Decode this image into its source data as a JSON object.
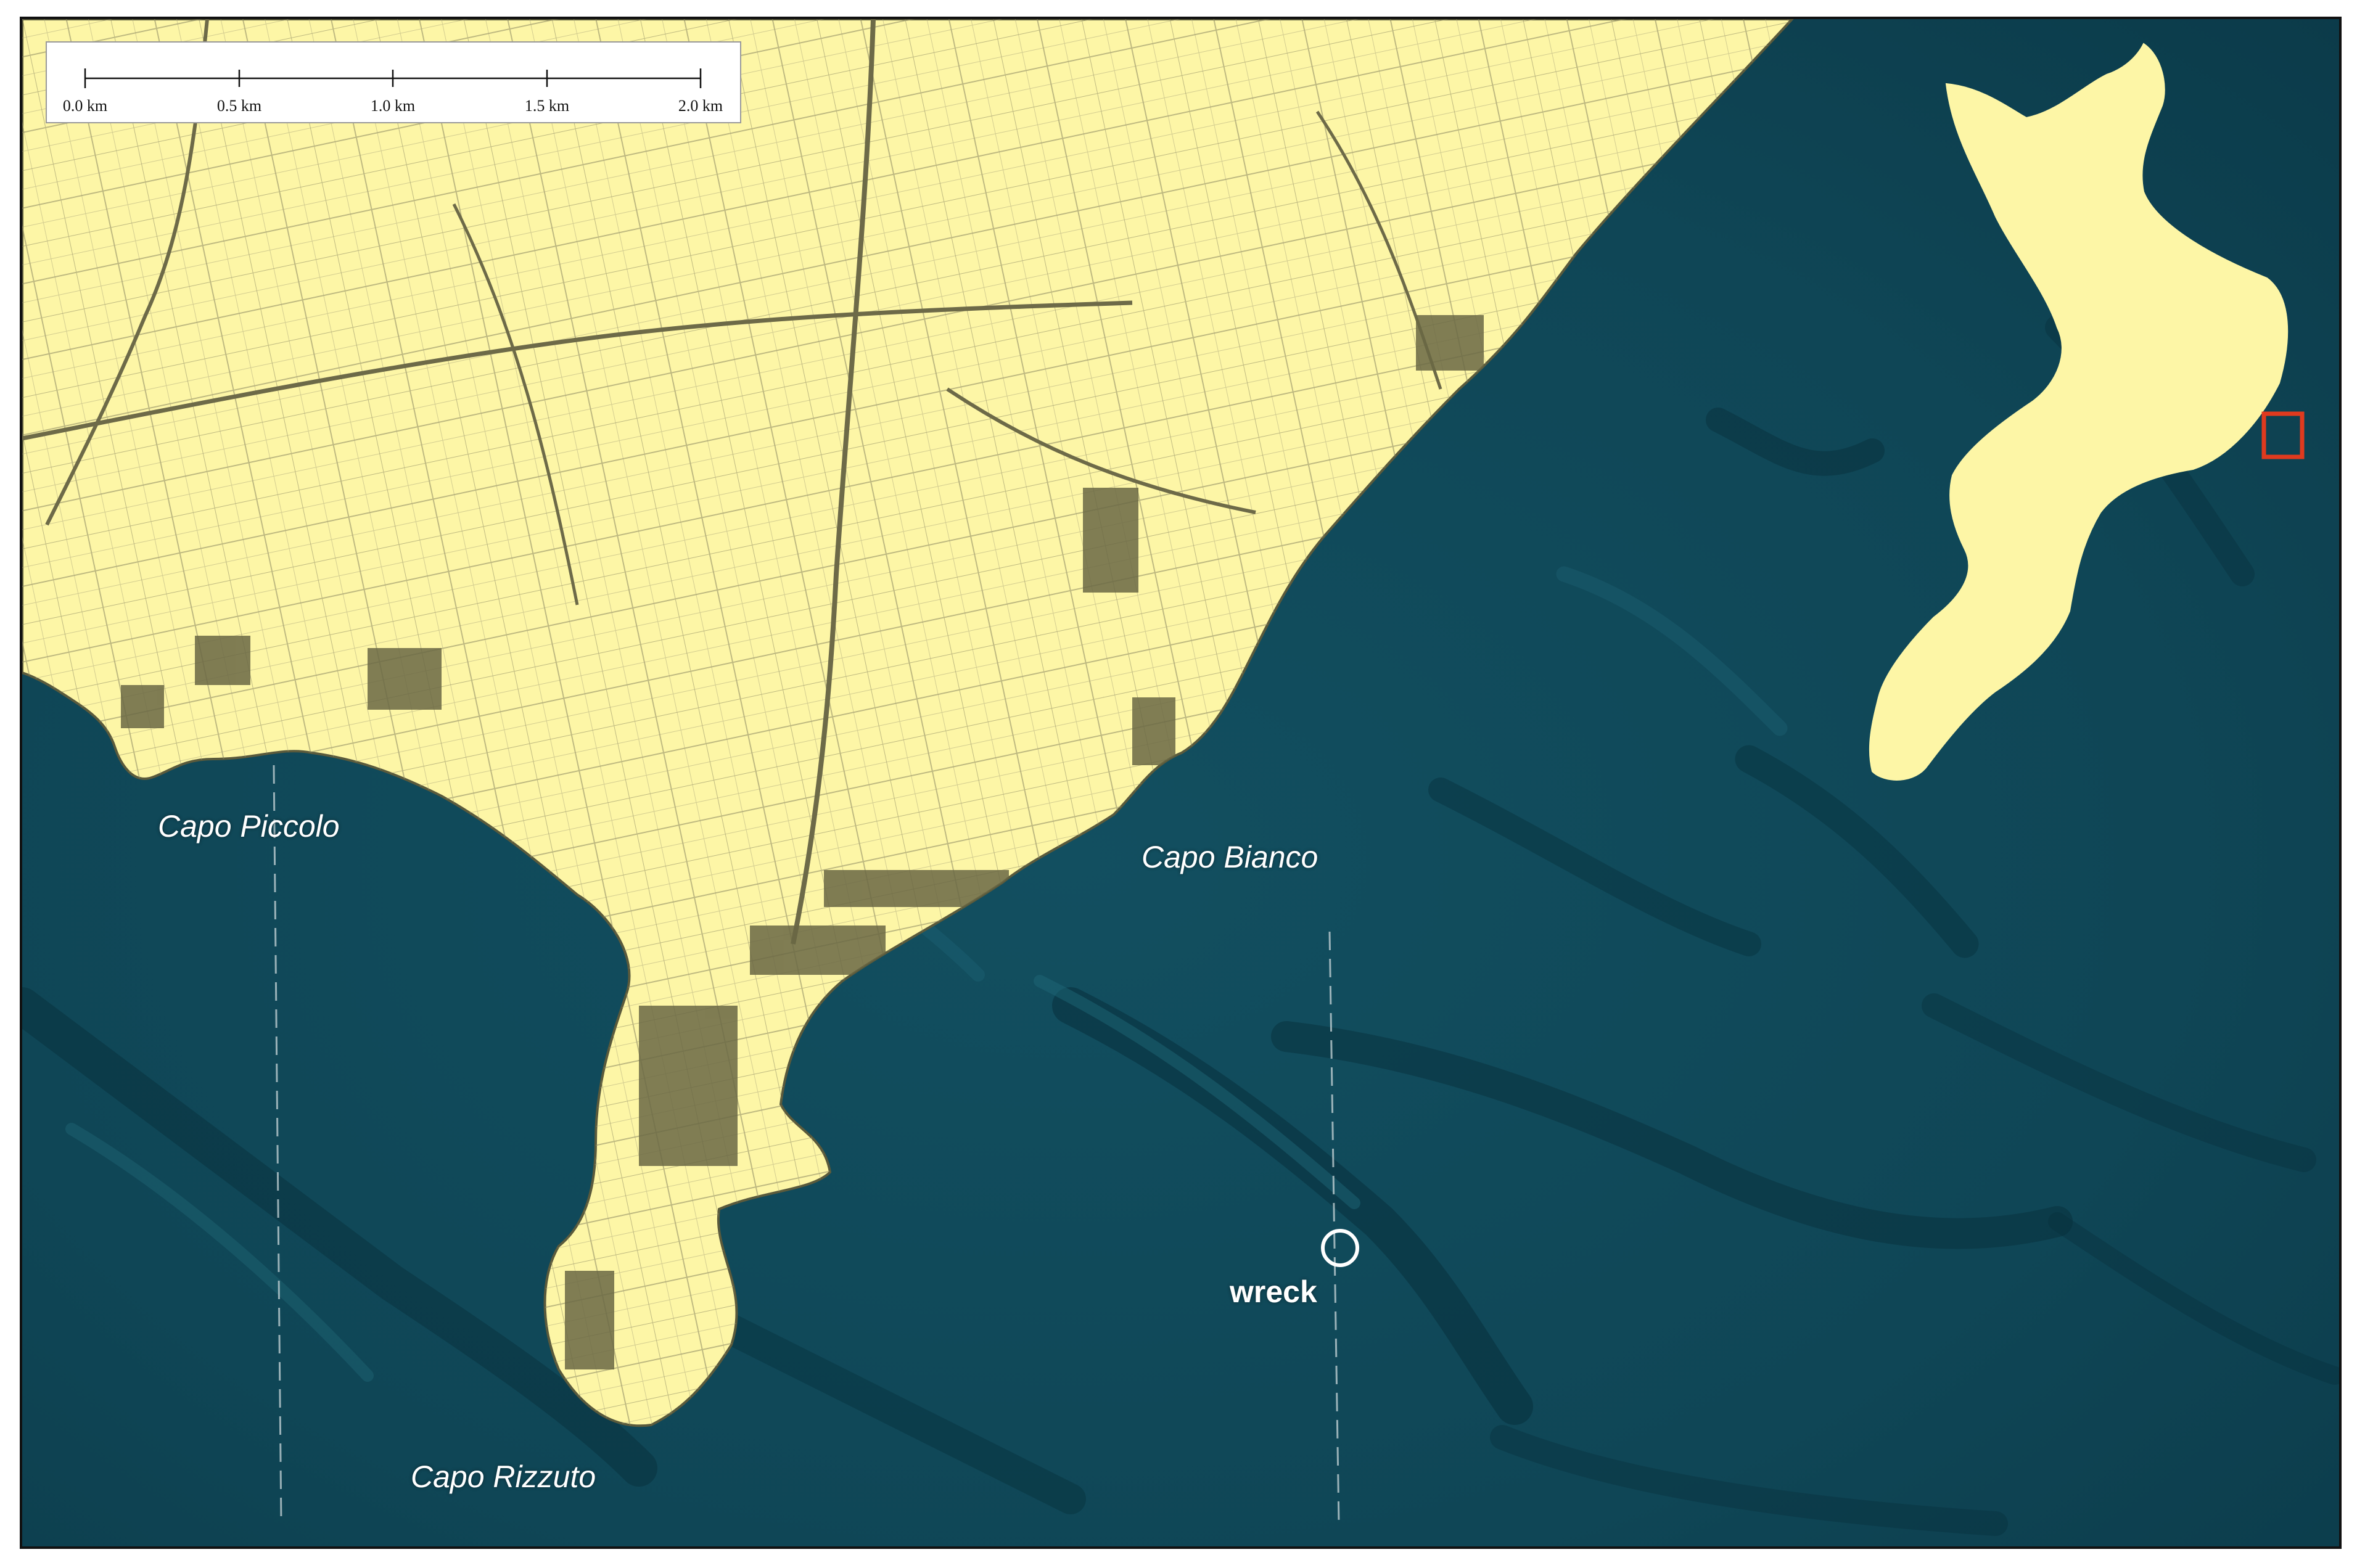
{
  "map": {
    "labels": {
      "capo_piccolo": "Capo Piccolo",
      "capo_bianco": "Capo Bianco",
      "capo_rizzuto": "Capo Rizzuto",
      "wreck": "wreck"
    },
    "scale_bar": {
      "ticks": [
        "0.0 km",
        "0.5 km",
        "1.0 km",
        "1.5 km",
        "2.0 km"
      ]
    },
    "colors": {
      "land": "#fdf6a6",
      "sea": "#0f4a5a",
      "inset_marker": "#e03a1e",
      "wreck_marker": "#ffffff"
    }
  }
}
